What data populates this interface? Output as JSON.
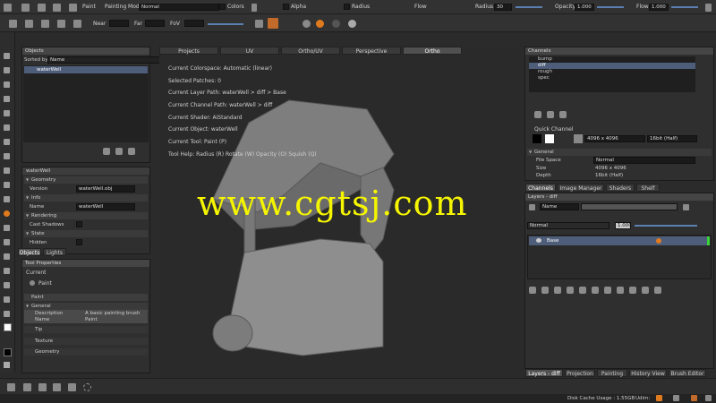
{
  "toolbar_top": {
    "paint_label": "Paint",
    "painting_mode_label": "Painting Mode",
    "painting_mode_value": "Normal",
    "colors_label": "Colors",
    "alpha_label": "Alpha",
    "radius_label": "Radius",
    "flow_label": "Flow",
    "radius2_label": "Radius",
    "radius2_value": "30",
    "opacity_label": "Opacity",
    "opacity_value": "1.000",
    "flow2_label": "Flow",
    "flow2_value": "1.000"
  },
  "toolbar_second": {
    "near_label": "Near",
    "far_label": "Far",
    "fov_label": "FoV"
  },
  "objects_panel": {
    "title": "Objects",
    "sorted_by_label": "Sorted by",
    "sorted_by_value": "Name",
    "items": [
      "waterWell"
    ]
  },
  "properties_panel": {
    "header": "waterWell",
    "geometry_section": "Geometry",
    "version_label": "Version",
    "version_value": "waterWell.obj",
    "info_section": "Info",
    "name_label": "Name",
    "name_value": "waterWell",
    "rendering_section": "Rendering",
    "cast_shadows_label": "Cast Shadows",
    "state_section": "State",
    "hidden_label": "Hidden",
    "tabs": [
      "Objects",
      "Lights"
    ]
  },
  "tool_properties": {
    "title": "Tool Properties",
    "current_label": "Current",
    "current_tool": "Paint",
    "paint_header": "Paint",
    "general_section": "General",
    "description_label": "Description",
    "description_value": "A basic painting brush",
    "name_label": "Name",
    "name_value": "Paint",
    "tip_label": "Tip",
    "texture_label": "Texture",
    "geometry_label": "Geometry"
  },
  "viewport": {
    "tabs": [
      "Projects",
      "UV",
      "Ortho/UV",
      "Perspective",
      "Ortho"
    ],
    "active_tab": "Ortho",
    "info_lines": [
      "Current Colorspace: Automatic (linear)",
      "Selected Patches: 0",
      "Current Layer Path: waterWell > diff > Base",
      "Current Channel Path: waterWell > diff",
      "Current Shader: AiStandard",
      "Current Object: waterWell",
      "Current Tool: Paint (P)",
      "Tool Help:   Radius (R)   Rotate (W)   Opacity (O)   Squish (Q)"
    ]
  },
  "channels_panel": {
    "title": "Channels",
    "items": [
      "bump",
      "diff",
      "rough",
      "spec"
    ],
    "selected": "diff",
    "quick_channel_label": "Quick Channel",
    "resolution": "4096 x 4096",
    "depth_value": "16bit (Half)",
    "general_section": "General",
    "file_space_label": "File Space",
    "file_space_value": "Normal",
    "size_label": "Size",
    "size_value": "4096 x 4096",
    "depth_label": "Depth",
    "depth_info_value": "16bit (Half)",
    "tabs": [
      "Channels",
      "Image Manager",
      "Shaders",
      "Shelf"
    ]
  },
  "layers_panel": {
    "title": "Layers - diff",
    "filter_value": "Name",
    "blend_mode": "Normal",
    "opacity_value": "1.000",
    "layers": [
      "Base"
    ],
    "bottom_tabs": [
      "Layers - diff",
      "Projection",
      "Painting",
      "History View",
      "Brush Editor"
    ]
  },
  "status_bar": {
    "disk_cache": "Disk Cache Usage : 1.55GB",
    "udim": "Udim:"
  },
  "watermark": "www.cgtsj.com",
  "colors": {
    "accent": "#5a7fb0",
    "selection": "#4d5d7a",
    "watermark": "#f5f500",
    "layer_green": "#3ad13a"
  }
}
